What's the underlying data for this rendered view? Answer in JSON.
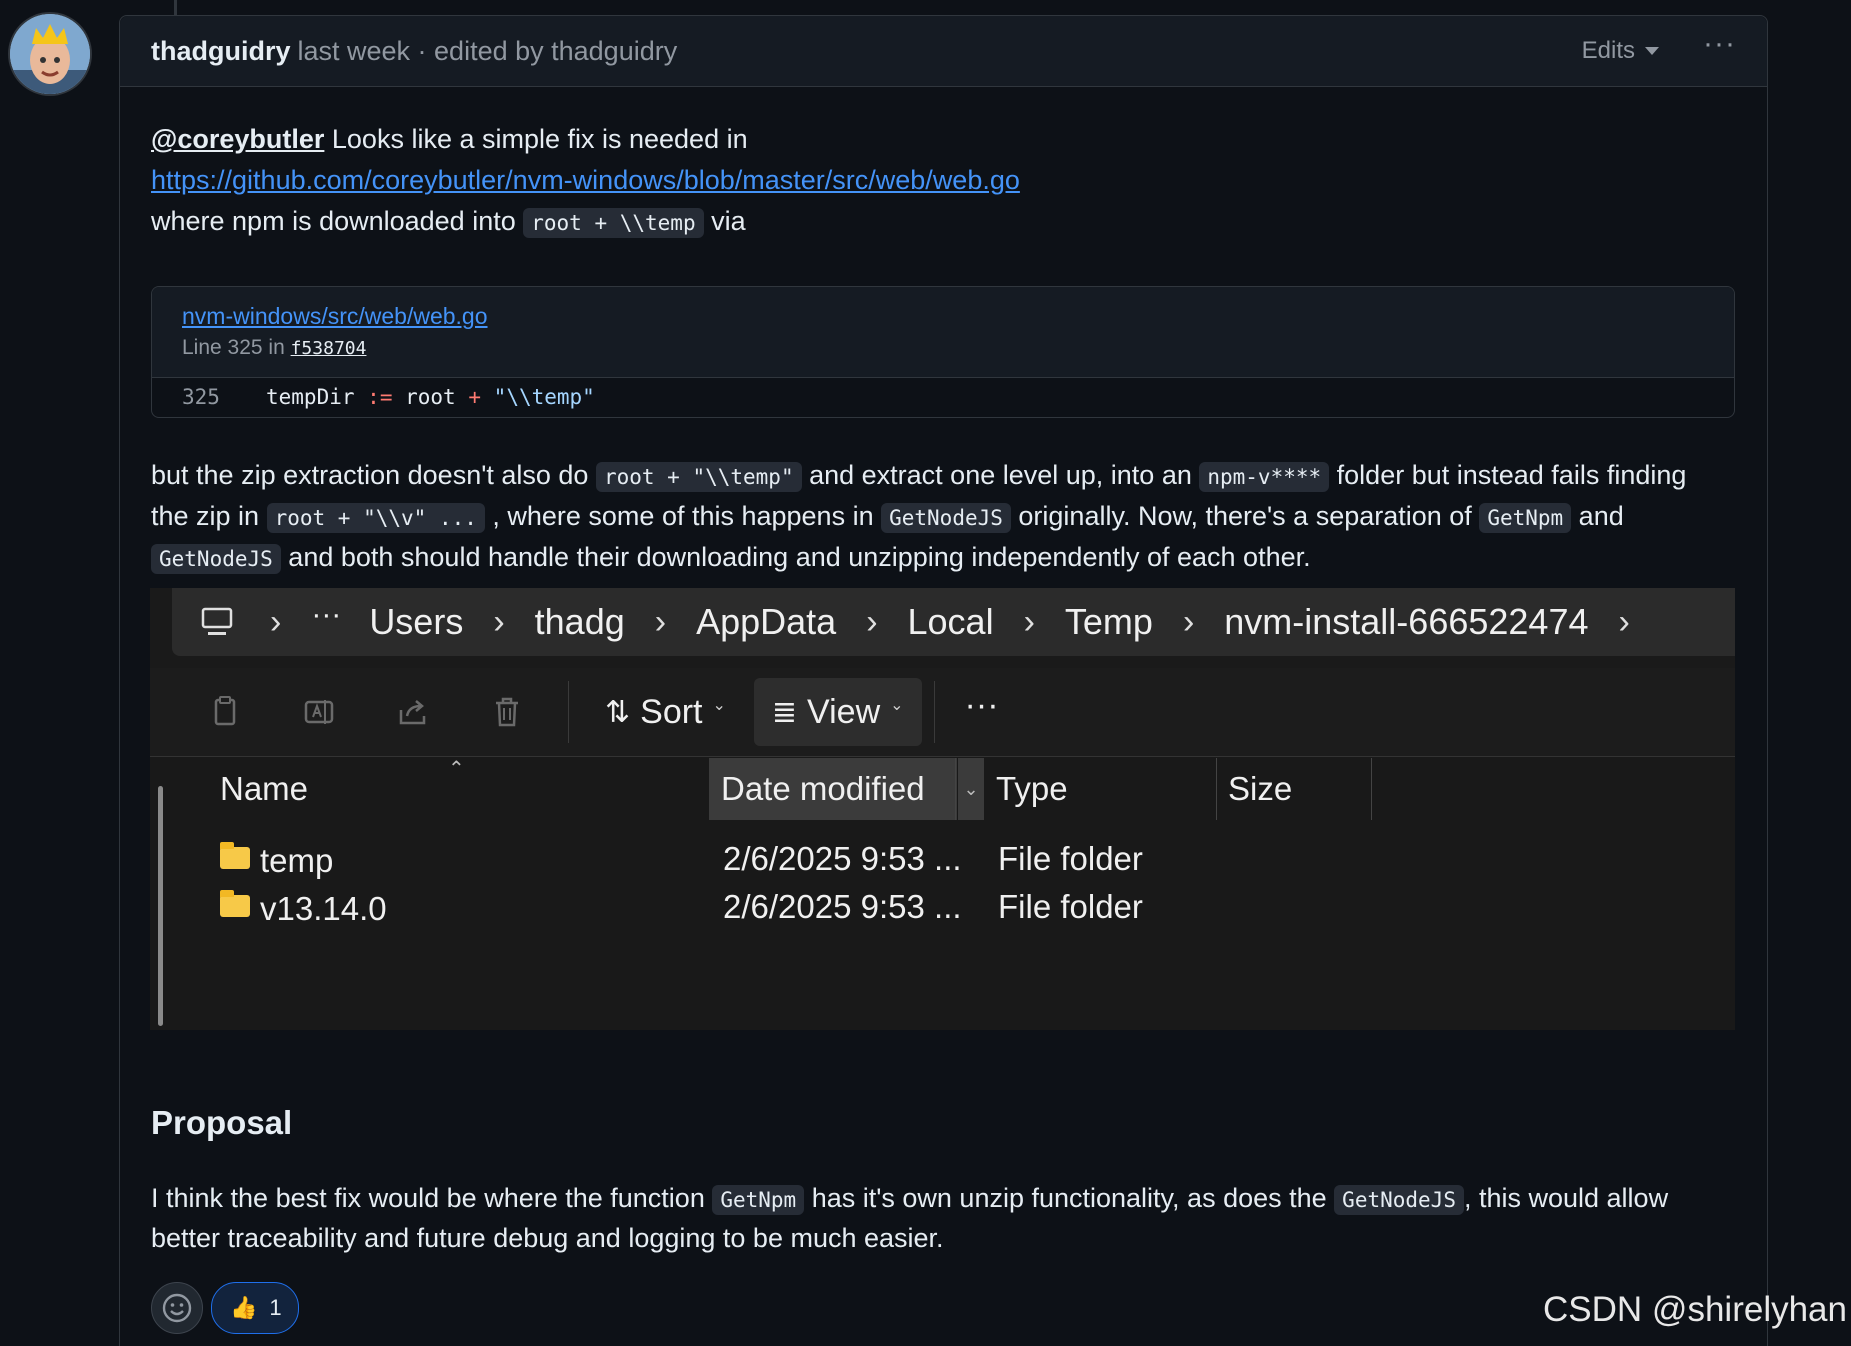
{
  "header": {
    "author": "thadguidry",
    "meta": "last week · edited by thadguidry",
    "edits_label": "Edits",
    "more_label": "···"
  },
  "intro": {
    "mention": "@coreybutler",
    "line1_rest": " Looks like a simple fix is needed in",
    "link": "https://github.com/coreybutler/nvm-windows/blob/master/src/web/web.go",
    "line3_pre": "where npm is downloaded into ",
    "line3_code": "root + \\\\temp",
    "line3_post": " via"
  },
  "permalink": {
    "file": "nvm-windows/src/web/web.go",
    "line_label": "Line 325 in ",
    "sha": "f538704",
    "line_number": "325",
    "code_ident": "tempDir",
    "code_op": ":=",
    "code_mid": "root",
    "code_plus": "+",
    "code_str": "\"\\\\temp\""
  },
  "paragraph2": {
    "l1_a": "but the zip extraction doesn't also do ",
    "l1_code1": "root + \"\\\\temp\"",
    "l1_b": " and extract one level up, into an ",
    "l1_code2": "npm-v****",
    "l1_c": " folder but instead fails finding",
    "l2_a": "the zip in ",
    "l2_code1": "root + \"\\\\v\" ...",
    "l2_b": " , where some of this happens in ",
    "l2_code2": "GetNodeJS",
    "l2_c": " originally. Now, there's a separation of ",
    "l2_code3": "GetNpm",
    "l2_d": " and",
    "l3_code1": "GetNodeJS",
    "l3_a": " and both should handle their downloading and unzipping independently of each other."
  },
  "explorer": {
    "breadcrumb": [
      "Users",
      "thadg",
      "AppData",
      "Local",
      "Temp",
      "nvm-install-666522474"
    ],
    "toolbar": {
      "sort": "Sort",
      "view": "View",
      "more": "···"
    },
    "columns": [
      "Name",
      "Date modified",
      "Type",
      "Size"
    ],
    "rows": [
      {
        "name": "temp",
        "date": "2/6/2025 9:53 ...",
        "type": "File folder",
        "size": ""
      },
      {
        "name": "v13.14.0",
        "date": "2/6/2025 9:53 ...",
        "type": "File folder",
        "size": ""
      }
    ]
  },
  "proposal": {
    "heading": "Proposal",
    "l1_a": "I think the best fix would be where the function ",
    "l1_code1": "GetNpm",
    "l1_b": " has it's own unzip functionality, as does the ",
    "l1_code2": "GetNodeJS",
    "l1_c": ", this would allow",
    "l2": "better traceability and future debug and logging to be much easier."
  },
  "reactions": {
    "thumbs_count": "1",
    "thumbs_emoji": "👍"
  },
  "watermark": "CSDN @shirelyhan",
  "colors": {
    "bg": "#0d1117",
    "link": "#4493f8",
    "border": "#30363d",
    "accent": "#1f6feb"
  }
}
